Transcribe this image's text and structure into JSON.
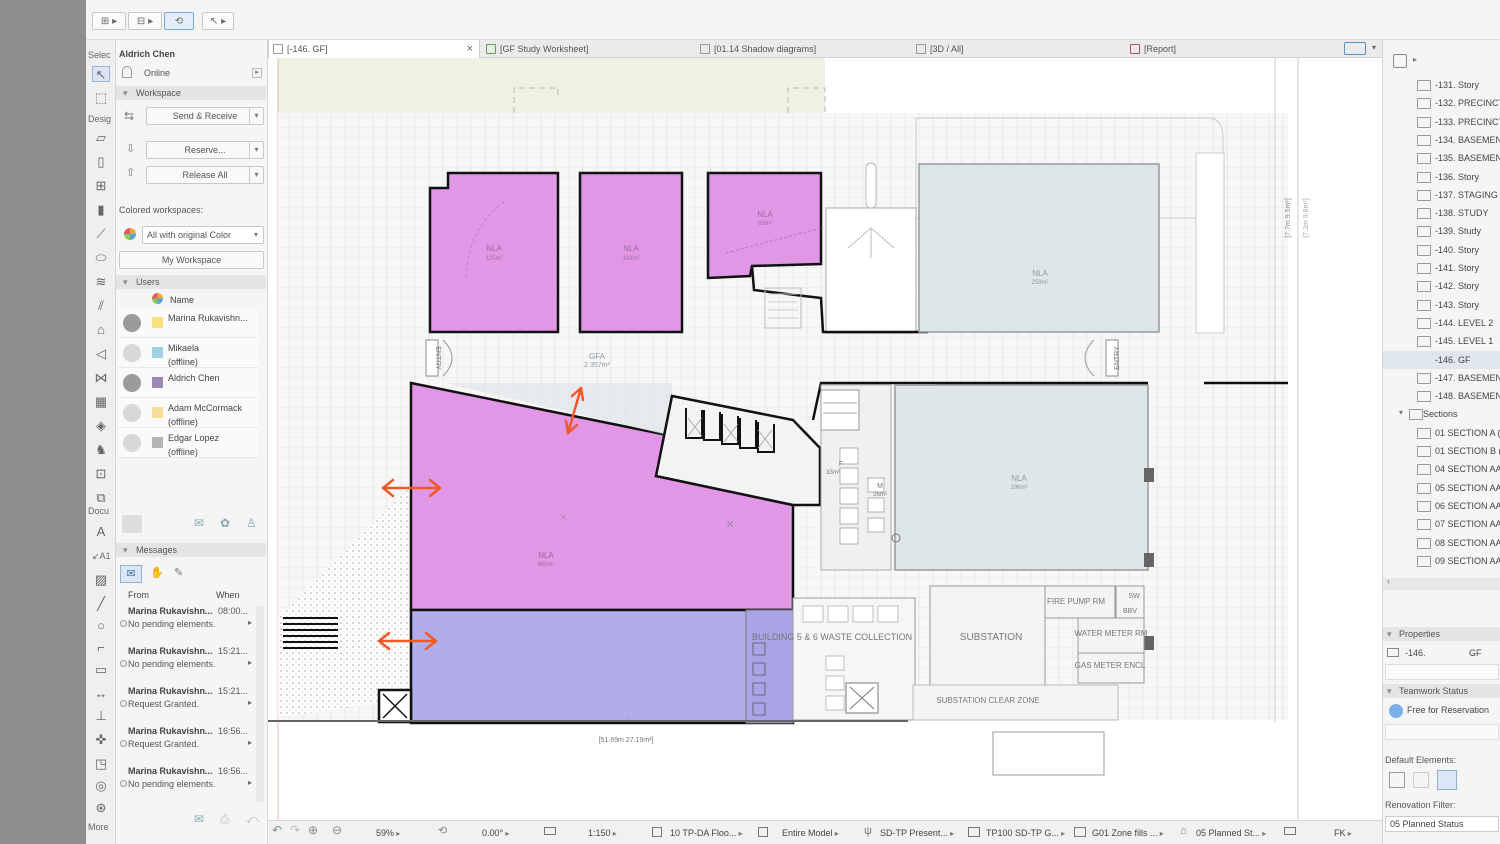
{
  "topbar": {
    "tools": [
      "⊞ ▸",
      "⊟ ▸",
      "⟲",
      "↖ ▸"
    ]
  },
  "toolbox": {
    "headers": {
      "select": "Selec",
      "design": "Desig",
      "document": "Docu",
      "more": "More"
    }
  },
  "teamwork": {
    "user_name": "Aldrich Chen",
    "status": "Online",
    "workspace_header": "Workspace",
    "send_receive": "Send & Receive",
    "reserve": "Reserve...",
    "release_all": "Release All",
    "colored_workspaces_label": "Colored workspaces:",
    "color_select": "All with original Color",
    "my_workspace": "My Workspace",
    "users_header": "Users",
    "users_col_name": "Name",
    "users": [
      {
        "name": "Marina Rukavishn...",
        "status": "",
        "color": "#f5e27a",
        "online": true
      },
      {
        "name": "Mikaela",
        "status": "(offline)",
        "color": "#9fd3df",
        "online": false
      },
      {
        "name": "Aldrich Chen",
        "status": "",
        "color": "#9b88b5",
        "online": true
      },
      {
        "name": "Adam McCormack",
        "status": "(offline)",
        "color": "#f7dd9a",
        "online": false
      },
      {
        "name": "Edgar Lopez",
        "status": "(offline)",
        "color": "#b5b5b5",
        "online": false
      }
    ],
    "messages_header": "Messages",
    "msg_col_from": "From",
    "msg_col_when": "When",
    "messages": [
      {
        "from": "Marina Rukavishn...",
        "time": "08:00...",
        "text": "No pending elements."
      },
      {
        "from": "Marina Rukavishn...",
        "time": "15:21...",
        "text": "No pending elements."
      },
      {
        "from": "Marina Rukavishn...",
        "time": "15:21...",
        "text": "Request Granted."
      },
      {
        "from": "Marina Rukavishn...",
        "time": "16:56...",
        "text": "Request Granted."
      },
      {
        "from": "Marina Rukavishn...",
        "time": "16:56...",
        "text": "No pending elements."
      }
    ]
  },
  "tabs": [
    {
      "label": "[-146. GF]",
      "active": true,
      "close": "×"
    },
    {
      "label": "[GF Study Worksheet]",
      "active": false
    },
    {
      "label": "[01.14 Shadow diagrams]",
      "active": false
    },
    {
      "label": "[3D / All]",
      "active": false
    },
    {
      "label": "[Report]",
      "active": false
    }
  ],
  "plan": {
    "zones": [
      {
        "label": "NLA",
        "area": "125m²"
      },
      {
        "label": "NLA",
        "area": "103m²"
      },
      {
        "label": "NLA",
        "area": "63m²"
      },
      {
        "label": "NLA",
        "area": "259m²"
      },
      {
        "label": "NLA",
        "area": "665m²"
      },
      {
        "label": "NLA",
        "area": "296m²"
      }
    ],
    "gfa_label": "GFA",
    "gfa_area": "2 357m²",
    "entry_left": "ENTRY",
    "entry_right": "ENTRY",
    "rooms": {
      "waste": "BUILDING 5 & 6 WASTE COLLECTION",
      "substation": "SUBSTATION",
      "fire_pump": "FIRE PUMP RM",
      "water_meter": "WATER METER RM",
      "gas_meter": "GAS METER ENCL",
      "clear_zone": "SUBSTATION CLEAR ZONE",
      "swr": "SW",
      "bbv": "BBV",
      "f_label": "F",
      "f_area": "33m²",
      "m_label": "M",
      "m_area": "26m²"
    },
    "dims": {
      "bottom": "[51.69m 27.19m²]",
      "right": "[7.7m 9.5m²]",
      "right_small": "[7.3m 9.8m²]"
    }
  },
  "statusbar": {
    "zoom": "59%",
    "angle": "0.00°",
    "scale": "1:150",
    "layer_combo": "10 TP-DA Floo...",
    "model": "Entire Model",
    "pen_set": "SD-TP Present...",
    "graphic_override": "TP100 SD-TP G...",
    "zone_fills": "G01 Zone fills ...",
    "planned": "05 Planned St...",
    "dim": "FK"
  },
  "navigator": {
    "stories": [
      "-131. Story",
      "-132. PRECINCT",
      "-133. PRECINCT",
      "-134. BASEMENT",
      "-135. BASEMENT",
      "-136. Story",
      "-137. STAGING B",
      "-138. STUDY",
      "-139. Study",
      "-140. Story",
      "-141. Story",
      "-142. Story",
      "-143. Story",
      "-144. LEVEL 2",
      "-145. LEVEL 1",
      "-146. GF",
      "-147. BASEMENT",
      "-148. BASEMENT"
    ],
    "sections_label": "Sections",
    "sections": [
      "01 SECTION A (",
      "01 SECTION B (",
      "04 SECTION AA",
      "05 SECTION AA",
      "06 SECTION AA",
      "07 SECTION AA",
      "08 SECTION AA",
      "09 SECTION AA",
      "10 SECTION AA"
    ],
    "properties_header": "Properties",
    "prop_story_num": "-146.",
    "prop_story_name": "GF",
    "teamwork_status_header": "Teamwork Status",
    "teamwork_status": "Free for Reservation",
    "default_elements_label": "Default Elements:",
    "renovation_filter_label": "Renovation Filter:",
    "renovation_filter": "05 Planned Status"
  },
  "colors": {
    "zone_pink": "#e197e6",
    "zone_blue": "#b1acea",
    "zone_grey": "#dfe6ea",
    "arrow": "#f05a28"
  }
}
